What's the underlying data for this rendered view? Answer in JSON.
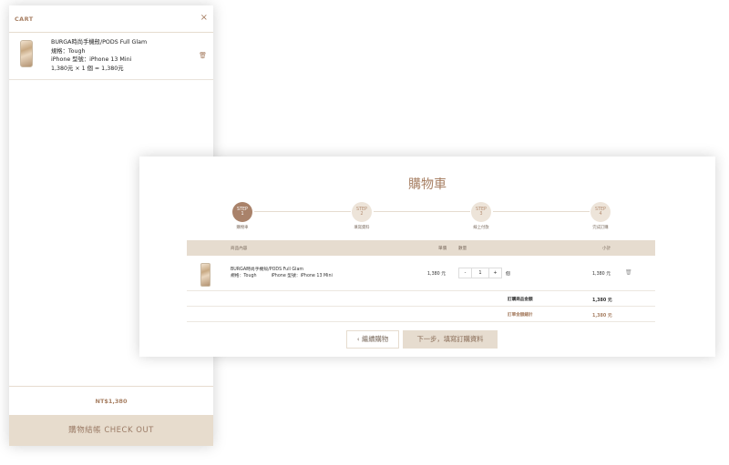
{
  "cart": {
    "title": "CART",
    "close_icon": "×",
    "item": {
      "name": "BURGA時尚手機殼/PODS Full Glam",
      "spec": "規格：Tough",
      "model": "iPhone 型號：iPhone 13 Mini",
      "price_line": "1,380元 × 1 個 = 1,380元",
      "trash_icon": "🗑"
    },
    "total": "NT$1,380",
    "checkout_label": "購物結帳 CHECK OUT"
  },
  "page": {
    "title": "購物車",
    "steps": [
      {
        "step": "STEP",
        "num": "1",
        "label": "購物車"
      },
      {
        "step": "STEP",
        "num": "2",
        "label": "填寫資料"
      },
      {
        "step": "STEP",
        "num": "3",
        "label": "線上付款"
      },
      {
        "step": "STEP",
        "num": "4",
        "label": "完成訂購"
      }
    ],
    "table_headers": {
      "product": "商品內容",
      "price": "單價",
      "qty": "數量",
      "subtotal": "小計"
    },
    "product": {
      "name": "BURGA時尚手機殼/PODS Full Glam",
      "spec": "規格：Tough",
      "model": "iPhone 型號：iPhone 13 Mini",
      "price": "1,380 元",
      "qty_minus": "-",
      "qty_value": "1",
      "qty_plus": "+",
      "qty_unit": "個",
      "subtotal": "1,380 元",
      "trash_icon": "🗑"
    },
    "summary": {
      "items_total_label": "訂購商品金額",
      "items_total_value": "1,380 元",
      "grand_total_label": "訂單金額總計",
      "grand_total_value": "1,380 元"
    },
    "continue_label": "‹ 繼續購物",
    "next_label": "下一步，填寫訂購資料"
  },
  "colors": {
    "accent": "#a77f63",
    "beige": "#e6dccf",
    "active_step": "#a9826a"
  }
}
